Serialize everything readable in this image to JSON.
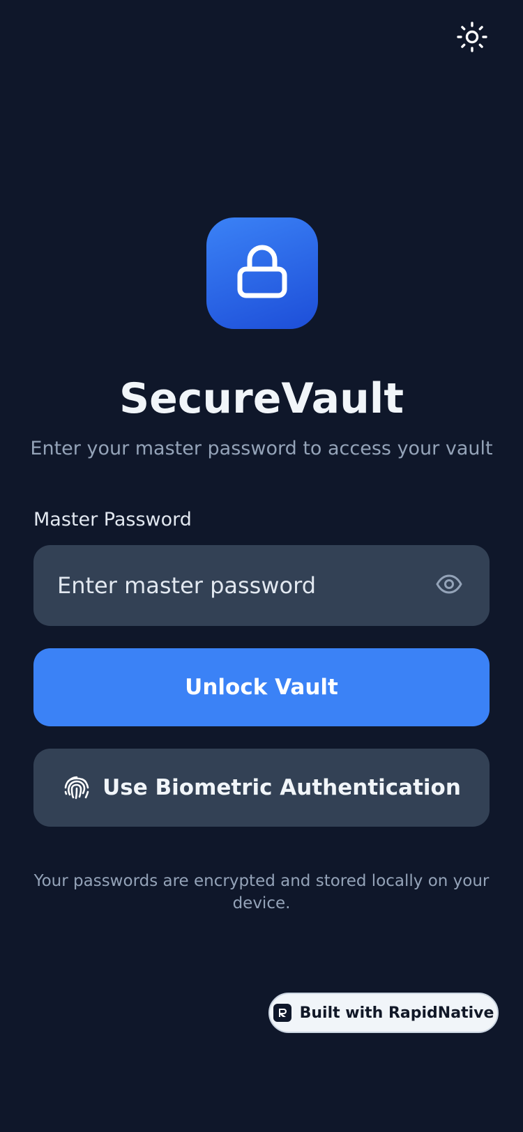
{
  "header": {
    "theme_toggle_icon": "sun-icon"
  },
  "brand": {
    "icon": "lock-icon",
    "title": "SecureVault",
    "subtitle": "Enter your master password to access your vault"
  },
  "form": {
    "password_label": "Master Password",
    "password_placeholder": "Enter master password",
    "password_value": "",
    "visibility_icon": "eye-icon"
  },
  "actions": {
    "unlock_label": "Unlock Vault",
    "biometric_label": "Use Biometric Authentication",
    "biometric_icon": "fingerprint-icon"
  },
  "footer": {
    "note": "Your passwords are encrypted and stored locally on your device.",
    "badge_label": "Built with RapidNative"
  },
  "colors": {
    "background": "#0f172a",
    "accent": "#3b82f6",
    "surface": "#334155",
    "muted_text": "#94a3b8"
  }
}
